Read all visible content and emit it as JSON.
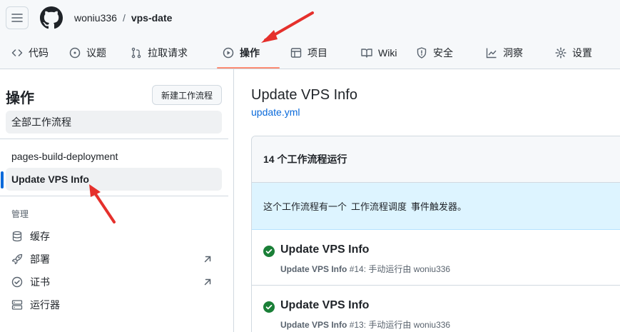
{
  "header": {
    "owner": "woniu336",
    "separator": "/",
    "repo": "vps-date"
  },
  "nav": {
    "tabs": [
      {
        "label": "代码",
        "icon": "code-icon"
      },
      {
        "label": "议题",
        "icon": "issue-icon"
      },
      {
        "label": "拉取请求",
        "icon": "pull-request-icon"
      },
      {
        "label": "操作",
        "icon": "play-icon"
      },
      {
        "label": "项目",
        "icon": "table-icon"
      },
      {
        "label": "Wiki",
        "icon": "book-icon"
      },
      {
        "label": "安全",
        "icon": "shield-icon"
      },
      {
        "label": "洞察",
        "icon": "graph-icon"
      },
      {
        "label": "设置",
        "icon": "gear-icon"
      }
    ],
    "active": "操作"
  },
  "sidebar": {
    "title": "操作",
    "new_workflow": "新建工作流程",
    "all_workflows": "全部工作流程",
    "workflows": [
      "pages-build-deployment",
      "Update VPS Info"
    ],
    "manage_heading": "管理",
    "manage_items": [
      {
        "label": "缓存",
        "icon": "database-icon"
      },
      {
        "label": "部署",
        "icon": "rocket-icon"
      },
      {
        "label": "证书",
        "icon": "verified-icon"
      },
      {
        "label": "运行器",
        "icon": "server-icon"
      }
    ]
  },
  "main": {
    "title": "Update VPS Info",
    "file": "update.yml",
    "runs_count": "14 个工作流程运行",
    "info_part1": "这个工作流程有一个",
    "info_code": "工作流程调度",
    "info_part2": "事件触发器。",
    "runs": [
      {
        "title": "Update VPS Info",
        "name": "Update VPS Info",
        "meta": "#14: 手动运行由 woniu336"
      },
      {
        "title": "Update VPS Info",
        "name": "Update VPS Info",
        "meta": "#13: 手动运行由 woniu336"
      }
    ]
  },
  "colors": {
    "accent": "#0969da",
    "active_underline": "#fd8c73",
    "success": "#1a7f37",
    "annotation": "#e5302c"
  }
}
